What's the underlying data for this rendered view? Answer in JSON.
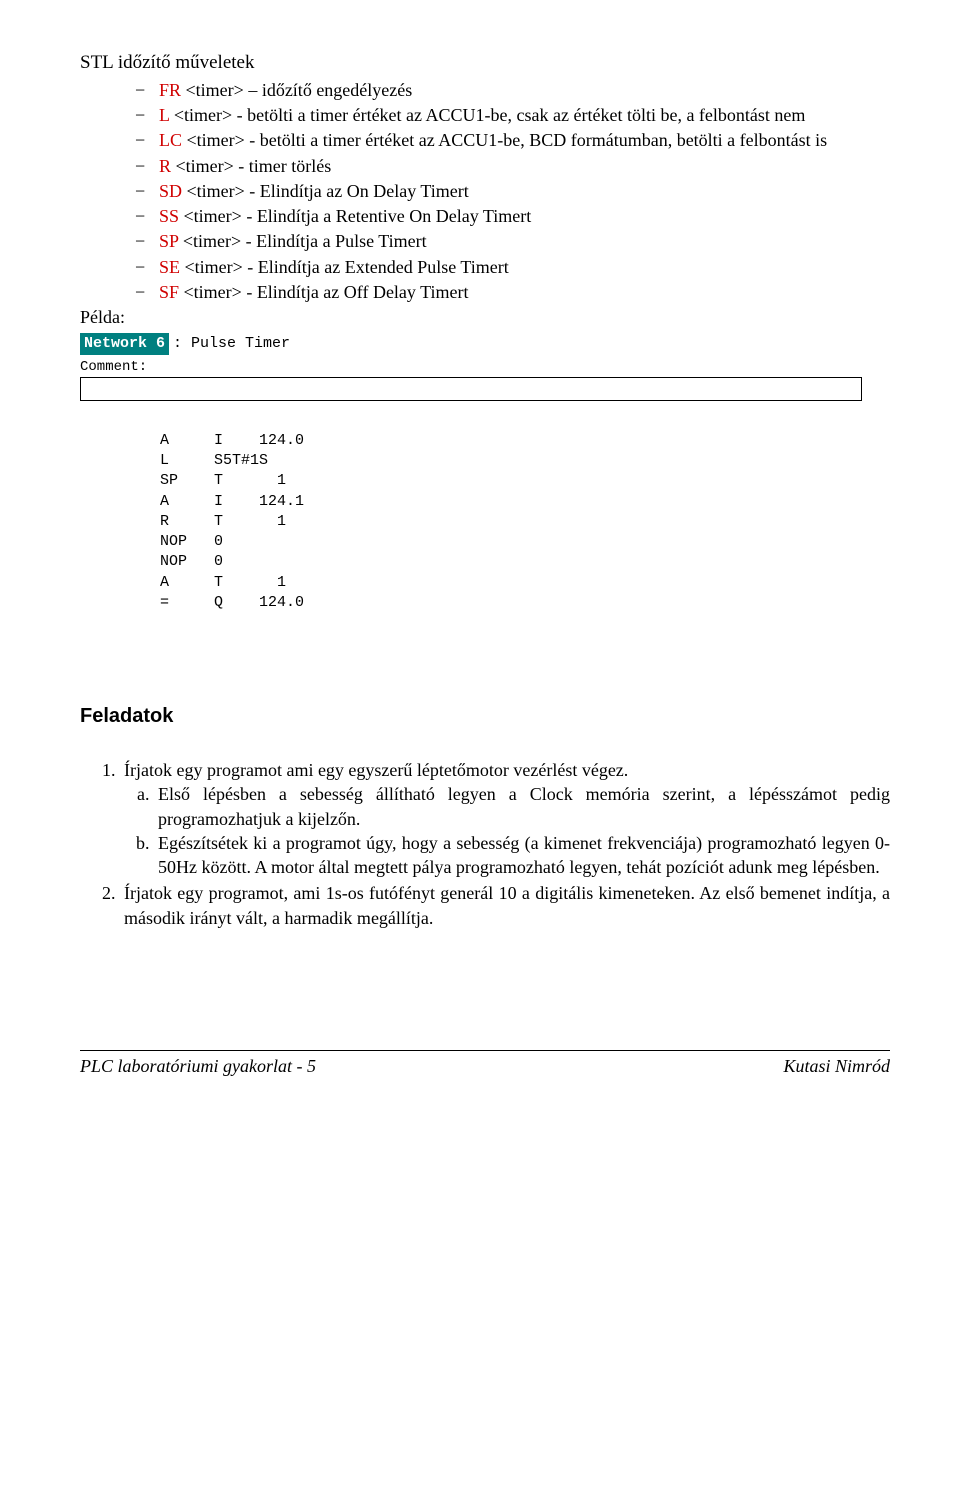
{
  "title": "STL időzítő műveletek",
  "bullets": [
    {
      "code": "FR",
      "text": " <timer> – időzítő engedélyezés"
    },
    {
      "code": "L",
      "text": " <timer> - betölti a timer értéket az ACCU1-be, csak az értéket tölti be, a felbontást nem"
    },
    {
      "code": "LC",
      "text": " <timer> - betölti a timer értéket az ACCU1-be, BCD formátumban, betölti a felbontást is"
    },
    {
      "code": "R",
      "text": " <timer> - timer törlés"
    },
    {
      "code": "SD",
      "text": " <timer> - Elindítja az On Delay Timert"
    },
    {
      "code": "SS",
      "text": " <timer> - Elindítja a Retentive On Delay Timert"
    },
    {
      "code": "SP",
      "text": " <timer> - Elindítja a Pulse Timert"
    },
    {
      "code": "SE",
      "text": " <timer> - Elindítja az Extended Pulse Timert"
    },
    {
      "code": "SF",
      "text": " <timer> - Elindítja az Off Delay Timert"
    }
  ],
  "pelda_label": "Példa:",
  "code": {
    "network_badge": "Network 6",
    "network_title": ": Pulse Timer",
    "comment_label": "Comment:",
    "lines": "A     I    124.0\nL     S5T#1S\nSP    T      1\nA     I    124.1\nR     T      1\nNOP   0\nNOP   0\nA     T      1\n=     Q    124.0"
  },
  "feladatok_heading": "Feladatok",
  "tasks": [
    {
      "text": "Írjatok egy programot ami egy egyszerű léptetőmotor vezérlést végez.",
      "subs": [
        "Első lépésben a sebesség állítható legyen a Clock memória szerint, a lépésszámot pedig programozhatjuk a kijelzőn.",
        "Egészítsétek ki a programot úgy, hogy a sebesség (a kimenet frekvenciája) programozható legyen 0-50Hz között. A motor által megtett pálya programozható legyen, tehát pozíciót adunk meg lépésben."
      ]
    },
    {
      "text": "Írjatok egy programot, ami 1s-os futófényt generál 10 a digitális kimeneteken. Az első bemenet indítja, a második irányt vált, a harmadik megállítja.",
      "subs": []
    }
  ],
  "footer": {
    "left": "PLC laboratóriumi gyakorlat - 5",
    "right": "Kutasi Nimród"
  }
}
